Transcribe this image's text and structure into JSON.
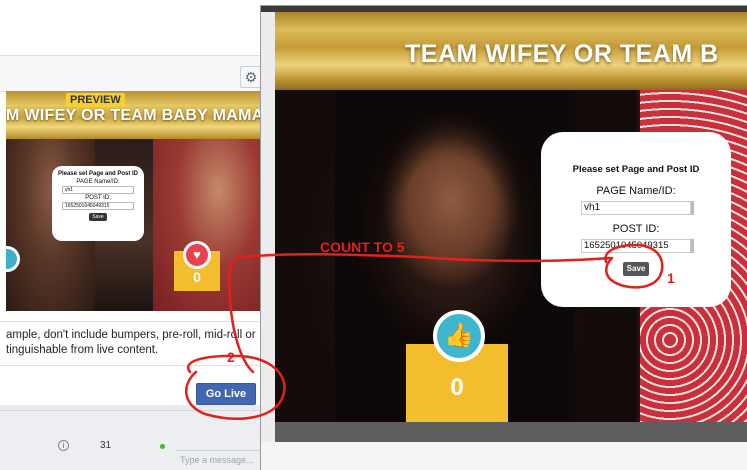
{
  "left_window": {
    "preview_badge": "PREVIEW",
    "banner_text": "M WIFEY OR TEAM BABY MAMAS?",
    "mini_form": {
      "title": "Please set Page and Post ID",
      "page_label": "PAGE Name/ID:",
      "page_value": "vh1",
      "post_label": "POST ID:",
      "post_value": "1652501045049315",
      "save_label": "Save"
    },
    "heart_count": "0",
    "description_line1": "ample, don't include bumpers, pre-roll, mid-roll or",
    "description_line2": "tinguishable from live content.",
    "go_live_label": "Go Live",
    "gear_icon": "gear-icon"
  },
  "bottom_bar": {
    "count": "31",
    "message_placeholder": "Type a message..."
  },
  "right_window": {
    "banner_text": "TEAM WIFEY OR TEAM B",
    "form": {
      "title": "Please set Page and Post ID",
      "page_label": "PAGE Name/ID:",
      "page_value": "vh1",
      "post_label": "POST ID:",
      "post_value": "1652501045049315",
      "save_label": "Save"
    },
    "like_count": "0",
    "like_icon": "thumbs-up-icon"
  },
  "annotations": {
    "count_to": "COUNT TO 5",
    "step1": "1",
    "step2": "2",
    "color": "#e2211c"
  }
}
